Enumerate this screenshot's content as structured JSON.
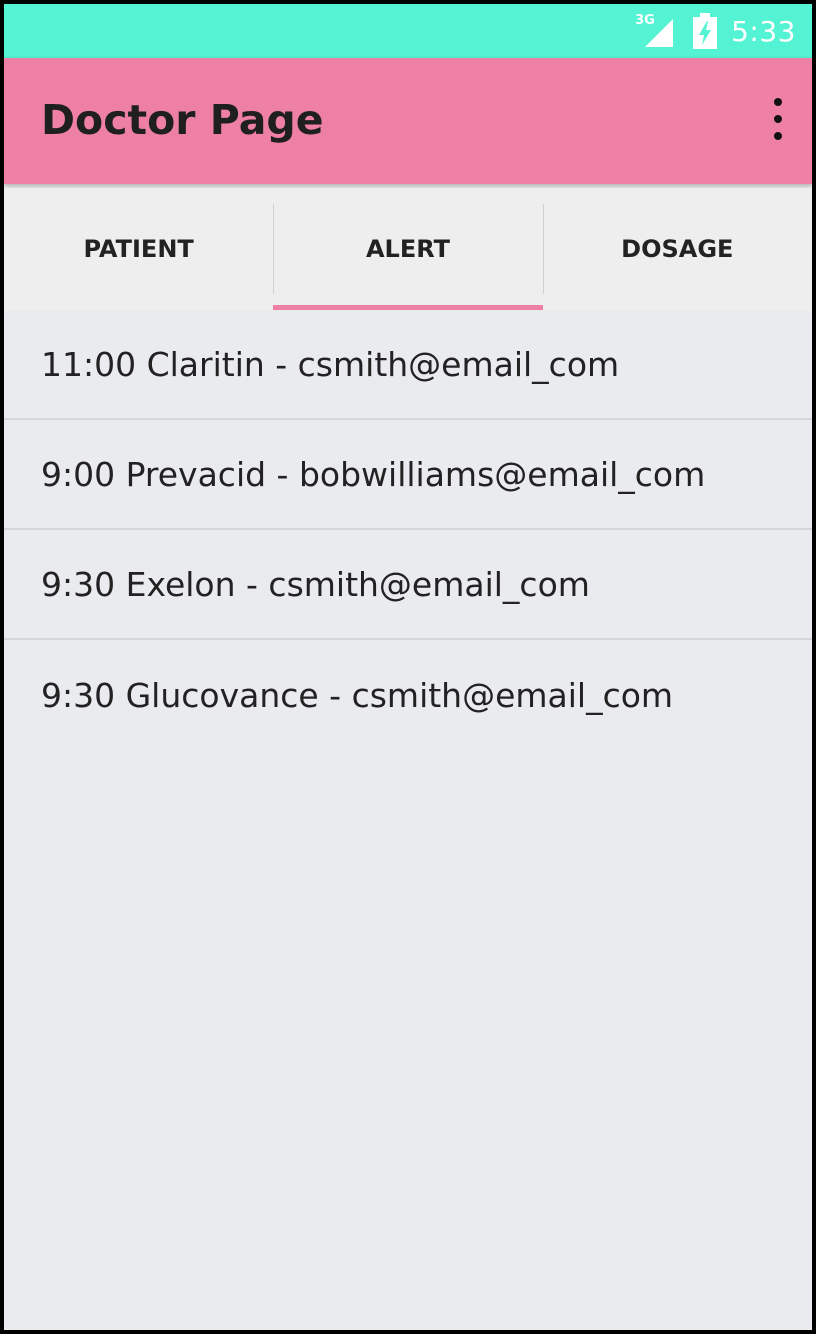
{
  "status_bar": {
    "network_type": "3G",
    "time": "5:33",
    "color": "#53f3d3",
    "icons": [
      "signal-icon",
      "battery-charging-icon"
    ]
  },
  "app_bar": {
    "title": "Doctor Page",
    "color": "#ef80a5",
    "menu_icon": "overflow-menu-icon"
  },
  "tabs": [
    {
      "label": "PATIENT",
      "active": false
    },
    {
      "label": "ALERT",
      "active": true
    },
    {
      "label": "DOSAGE",
      "active": false
    }
  ],
  "alerts": [
    "11:00 Claritin - csmith@email_com",
    "9:00 Prevacid - bobwilliams@email_com",
    "9:30 Exelon - csmith@email_com",
    "9:30 Glucovance - csmith@email_com"
  ]
}
